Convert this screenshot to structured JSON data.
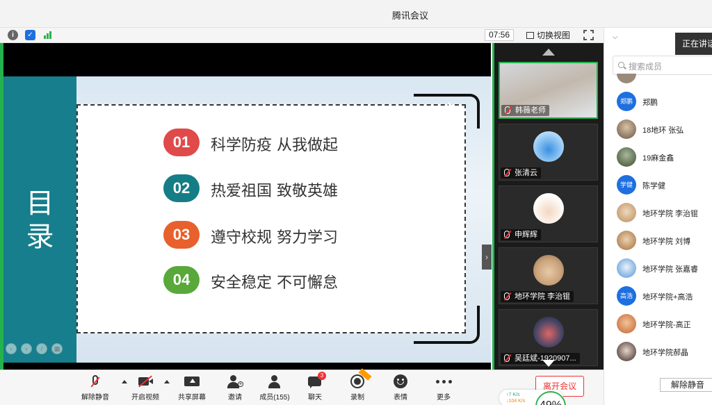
{
  "window": {
    "title": "腾讯会议"
  },
  "infobar": {
    "timer": "07:56",
    "switch_view": "切换视图"
  },
  "slide": {
    "heading_top": "目",
    "heading_bottom": "录",
    "items": [
      {
        "num": "01",
        "text": "科学防疫 从我做起",
        "color": "#e04a4a"
      },
      {
        "num": "02",
        "text": "热爱祖国 致敬英雄",
        "color": "#157d85"
      },
      {
        "num": "03",
        "text": "遵守校规 努力学习",
        "color": "#e8602c"
      },
      {
        "num": "04",
        "text": "安全稳定 不可懈怠",
        "color": "#58a83a"
      }
    ]
  },
  "video_tiles": [
    {
      "name": "韩薇老师",
      "active": true
    },
    {
      "name": "张清云"
    },
    {
      "name": "申辉辉"
    },
    {
      "name": "地环学院 李治锟"
    },
    {
      "name": "吴廷斌-1920907..."
    }
  ],
  "toolbar": {
    "unmute": "解除静音",
    "start_video": "开启视频",
    "share_screen": "共享屏幕",
    "invite": "邀请",
    "members": "成员(155)",
    "chat": "聊天",
    "chat_badge": "3",
    "record": "录制",
    "reactions": "表情",
    "more": "更多",
    "end_meeting": "离开会议",
    "net_up": "↑7  K/s",
    "net_down": "↓104 K/s",
    "cpu_percent": "49%"
  },
  "panel": {
    "speaking": "正在讲话",
    "search_placeholder": "搜索成员",
    "members": [
      {
        "name": "郑鹏",
        "avatar_text": "郑鹏",
        "avatar_color": "#1e6fe0"
      },
      {
        "name": "18地环 张弘",
        "avatar_text": "",
        "avatar_color": "#8a7560"
      },
      {
        "name": "19麻金鑫",
        "avatar_text": "",
        "avatar_color": "#5b6b4e"
      },
      {
        "name": "陈学健",
        "avatar_text": "学健",
        "avatar_color": "#1e6fe0"
      },
      {
        "name": "地环学院 李治锟",
        "avatar_text": "",
        "avatar_color": "#c9a27a"
      },
      {
        "name": "地环学院 刘博",
        "avatar_text": "",
        "avatar_color": "#b98b5e"
      },
      {
        "name": "地环学院 张嘉睿",
        "avatar_text": "",
        "avatar_color": "#7fb0e0"
      },
      {
        "name": "地环学院+高浩",
        "avatar_text": "高浩",
        "avatar_color": "#1e6fe0"
      },
      {
        "name": "地环学院-高正",
        "avatar_text": "",
        "avatar_color": "#d07f4e"
      },
      {
        "name": "地环学院郝晶",
        "avatar_text": "",
        "avatar_color": "#6a5a55"
      }
    ],
    "unmute_all": "解除静音"
  }
}
